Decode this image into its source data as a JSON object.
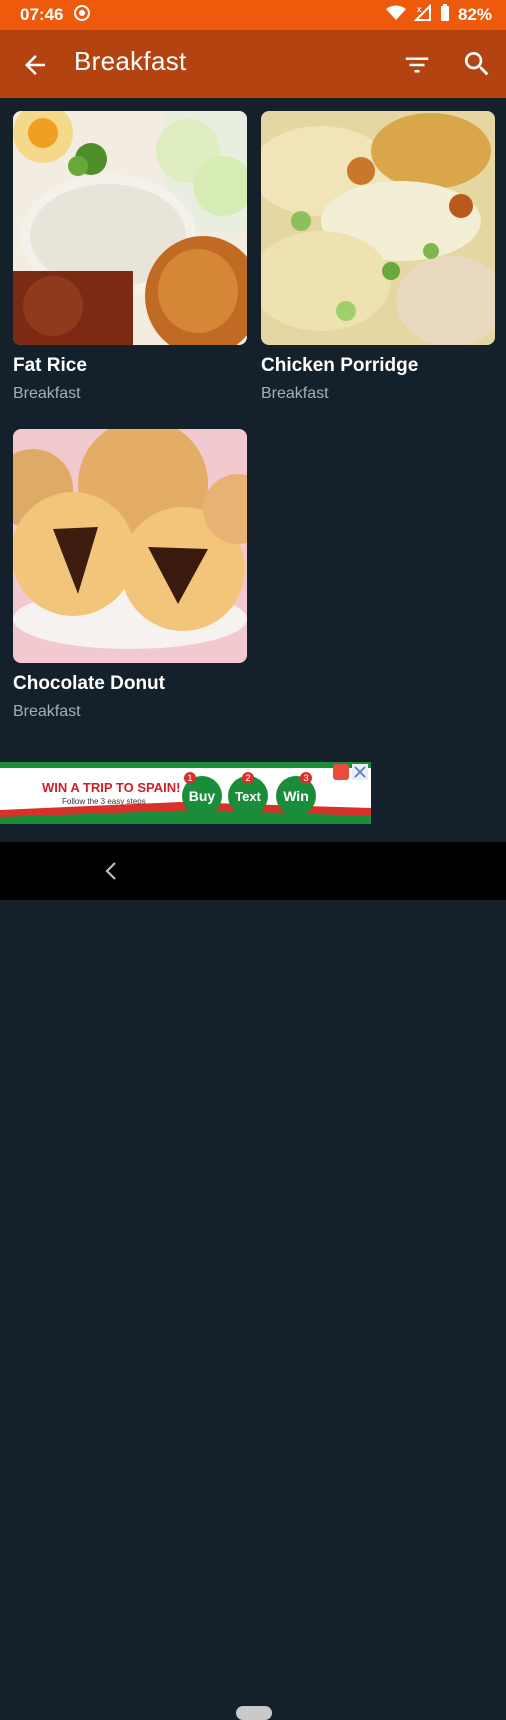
{
  "status_bar": {
    "time": "07:46",
    "battery": "82%"
  },
  "app_bar": {
    "title": "Breakfast"
  },
  "recipes": [
    {
      "name": "Fat Rice",
      "category": "Breakfast"
    },
    {
      "name": "Chicken Porridge",
      "category": "Breakfast"
    },
    {
      "name": "Chocolate Donut",
      "category": "Breakfast"
    }
  ],
  "ad": {
    "headline": "WIN A TRIP TO SPAIN!",
    "subline": "Follow the 3 easy steps",
    "steps": [
      {
        "num": "1",
        "label": "Buy"
      },
      {
        "num": "2",
        "label": "Text"
      },
      {
        "num": "3",
        "label": "Win"
      }
    ]
  },
  "colors": {
    "status_bar": "#ed5a0c",
    "app_bar": "#b34311",
    "background": "#15212a"
  }
}
